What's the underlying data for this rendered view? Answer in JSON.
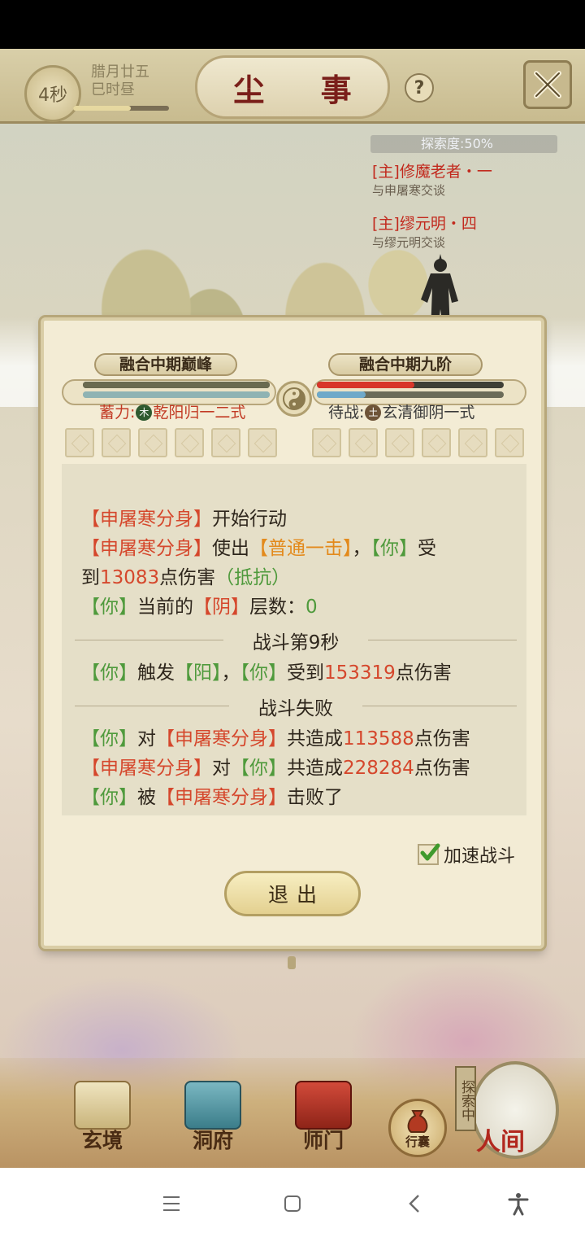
{
  "header": {
    "timer": "4秒",
    "date_line1": "腊月廿五",
    "date_line2": "巳时昼",
    "title": "尘 事",
    "help_label": "?",
    "day_progress": 0.6
  },
  "quest_panel": {
    "exploration": "探索度:50%",
    "quests": [
      {
        "title": "[主]修魔老者・一",
        "desc": "与申屠寒交谈"
      },
      {
        "title": "[主]缪元明・四",
        "desc": "与缪元明交谈"
      }
    ]
  },
  "battle": {
    "player_realm": "融合中期巅峰",
    "enemy_realm": "融合中期九阶",
    "player_hp": 1.0,
    "enemy_hp": 0.52,
    "enemy_mp": 0.26,
    "player_skill_prefix": "蓄力:",
    "player_skill_element": "木",
    "player_skill": "乾阳归一二式",
    "enemy_skill_prefix": "待战:",
    "enemy_skill_element": "土",
    "enemy_skill": "玄清御阴一式"
  },
  "log": {
    "l1": [
      "【申屠寒分身】",
      "开始行动"
    ],
    "l2": [
      "【申屠寒分身】",
      "使出",
      "【普通一击】",
      "，",
      "【你】",
      "受"
    ],
    "l3": [
      "到",
      "13083",
      "点伤害",
      "（抵抗）"
    ],
    "l4": [
      "【你】",
      "当前的",
      "【阴】",
      "层数：",
      "0"
    ],
    "div1": "战斗第9秒",
    "l5": [
      "【你】",
      "触发",
      "【阳】",
      "，",
      "【你】",
      "受到",
      "153319",
      "点伤害"
    ],
    "div2": "战斗失败",
    "l6": [
      "【你】",
      "对",
      "【申屠寒分身】",
      "共造成",
      "113588",
      "点伤害"
    ],
    "l7": [
      "【申屠寒分身】",
      "对",
      "【你】",
      "共造成",
      "228284",
      "点伤害"
    ],
    "l8": [
      "【你】",
      "被",
      "【申屠寒分身】",
      "击败了"
    ]
  },
  "controls": {
    "speed_label": "加速战斗",
    "speed_checked": true,
    "exit_label": "退出"
  },
  "bottom_nav": {
    "items": [
      "玄境",
      "洞府",
      "师门"
    ],
    "bag": "行囊",
    "exploring_tag": "探索中",
    "world": "人间"
  },
  "colors": {
    "name_red": "#d5472c",
    "you_green": "#4f9a3c",
    "skill_orange": "#e38a1c",
    "title_red": "#7a1f1a"
  }
}
